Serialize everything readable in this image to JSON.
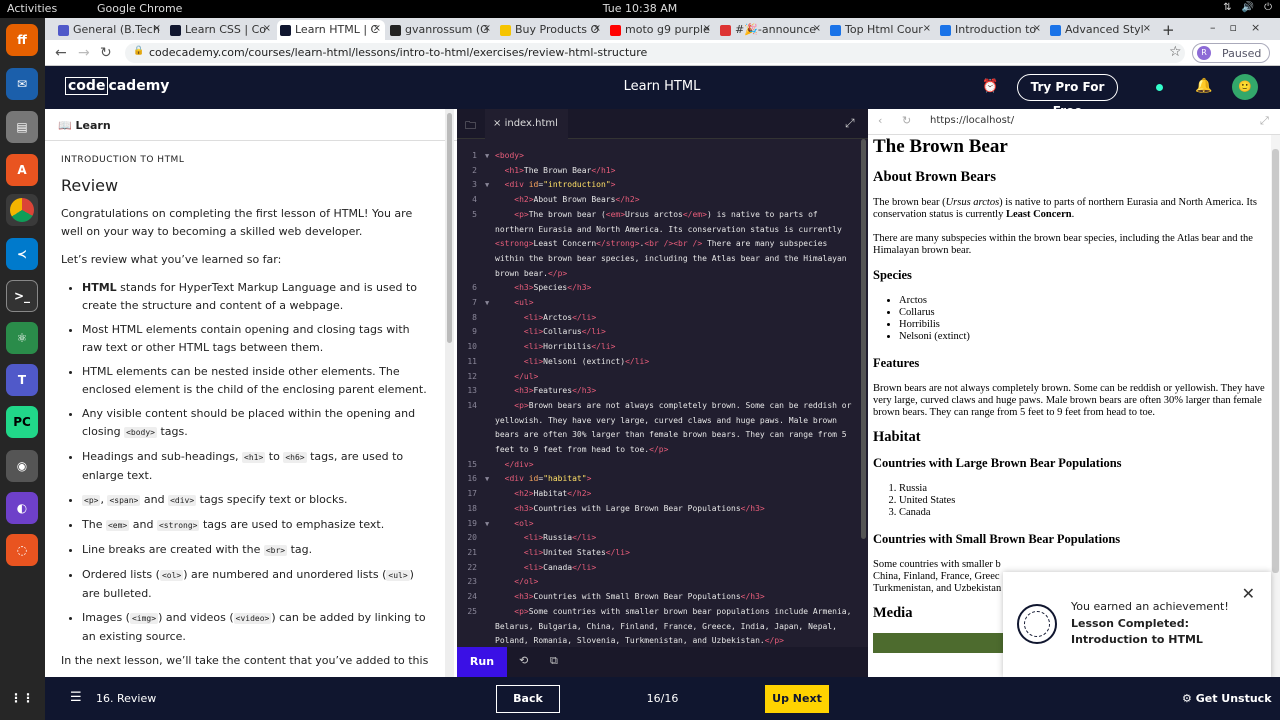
{
  "system": {
    "activities": "Activities",
    "app_name": "Google Chrome",
    "clock": "Tue 10:38 AM"
  },
  "tabs": [
    {
      "title": "General (B.Tech",
      "color": "#5059c9"
    },
    {
      "title": "Learn CSS | Co",
      "color": "#10162f"
    },
    {
      "title": "Learn HTML | C",
      "color": "#10162f",
      "active": true
    },
    {
      "title": "gvanrossum (G",
      "color": "#222"
    },
    {
      "title": "Buy Products O",
      "color": "#f5c400"
    },
    {
      "title": "moto g9 purple",
      "color": "#ff0000"
    },
    {
      "title": "#🎉-announce",
      "color": "#d33"
    },
    {
      "title": "Top Html Cour",
      "color": "#1a73e8"
    },
    {
      "title": "Introduction to",
      "color": "#1a73e8"
    },
    {
      "title": "Advanced Styl",
      "color": "#1a73e8"
    }
  ],
  "address": {
    "url": "codecademy.com/courses/learn-html/lessons/intro-to-html/exercises/review-html-structure",
    "profile_initial": "R",
    "paused_label": "Paused"
  },
  "header": {
    "logo_code": "code",
    "logo_rest": "cademy",
    "title": "Learn HTML",
    "try_pro": "Try Pro For Free",
    "avatar_initial": "🙂"
  },
  "learn": {
    "panel_title": "Learn",
    "kicker": "INTRODUCTION TO HTML",
    "heading": "Review",
    "intro": "Congratulations on completing the first lesson of HTML! You are well on your way to becoming a skilled web developer.",
    "lead": "Let’s review what you’ve learned so far:",
    "items": [
      {
        "pre": "HTML",
        "text": " stands for HyperText Markup Language and is used to create the structure and content of a webpage."
      },
      {
        "pre": "",
        "text": "Most HTML elements contain opening and closing tags with raw text or other HTML tags between them."
      },
      {
        "pre": "",
        "text": "HTML elements can be nested inside other elements. The enclosed element is the child of the enclosing parent element."
      },
      {
        "pre": "",
        "text": "Any visible content should be placed within the opening and closing ",
        "k1": "<body>",
        "post": " tags."
      },
      {
        "pre": "",
        "text": "Headings and sub-headings, ",
        "k1": "<h1>",
        "mid": " to ",
        "k2": "<h6>",
        "post": " tags, are used to enlarge text."
      },
      {
        "pre": "",
        "k1": "<p>",
        "mid": ", ",
        "k2": "<span>",
        "mid2": " and ",
        "k3": "<div>",
        "post": " tags specify text or blocks."
      },
      {
        "pre": "",
        "text": "The ",
        "k1": "<em>",
        "mid": " and ",
        "k2": "<strong>",
        "post": " tags are used to emphasize text."
      },
      {
        "pre": "",
        "text": "Line breaks are created with the ",
        "k1": "<br>",
        "post": " tag."
      },
      {
        "pre": "",
        "text": "Ordered lists (",
        "k1": "<ol>",
        "mid": ") are numbered and unordered lists (",
        "k2": "<ul>",
        "post": ") are bulleted."
      },
      {
        "pre": "",
        "text": "Images (",
        "k1": "<img>",
        "mid": ") and videos (",
        "k2": "<video>",
        "post": ") can be added by linking to an existing source."
      }
    ],
    "outro": "In the next lesson, we’ll take the content that you’ve added to this"
  },
  "editor": {
    "file": "index.html",
    "run": "Run"
  },
  "preview": {
    "url": "https://localhost/",
    "h1": "The Brown Bear",
    "h2_about": "About Brown Bears",
    "p1a": "The brown bear (",
    "p1em": "Ursus arctos",
    "p1b": ") is native to parts of northern Eurasia and North America. Its conservation status is currently ",
    "p1strong": "Least Concern",
    "p1c": ".",
    "p2": "There are many subspecies within the brown bear species, including the Atlas bear and the Himalayan brown bear.",
    "h3_species": "Species",
    "species": [
      "Arctos",
      "Collarus",
      "Horribilis",
      "Nelsoni (extinct)"
    ],
    "h3_features": "Features",
    "p3": "Brown bears are not always completely brown. Some can be reddish or yellowish. They have very large, curved claws and huge paws. Male brown bears are often 30% larger than female brown bears. They can range from 5 feet to 9 feet from head to toe.",
    "h2_habitat": "Habitat",
    "h3_large": "Countries with Large Brown Bear Populations",
    "large": [
      "Russia",
      "United States",
      "Canada"
    ],
    "h3_small": "Countries with Small Brown Bear Populations",
    "p4": "Some countries with smaller b China, Finland, France, Greec Turkmenistan, and Uzbekistan",
    "h2_media": "Media"
  },
  "toast": {
    "line1": "You earned an achievement!",
    "line2": "Lesson Completed: Introduction to HTML"
  },
  "footer": {
    "lesson": "16. Review",
    "back": "Back",
    "progress": "16/16",
    "up_next": "Up Next",
    "unstuck": "Get Unstuck"
  }
}
